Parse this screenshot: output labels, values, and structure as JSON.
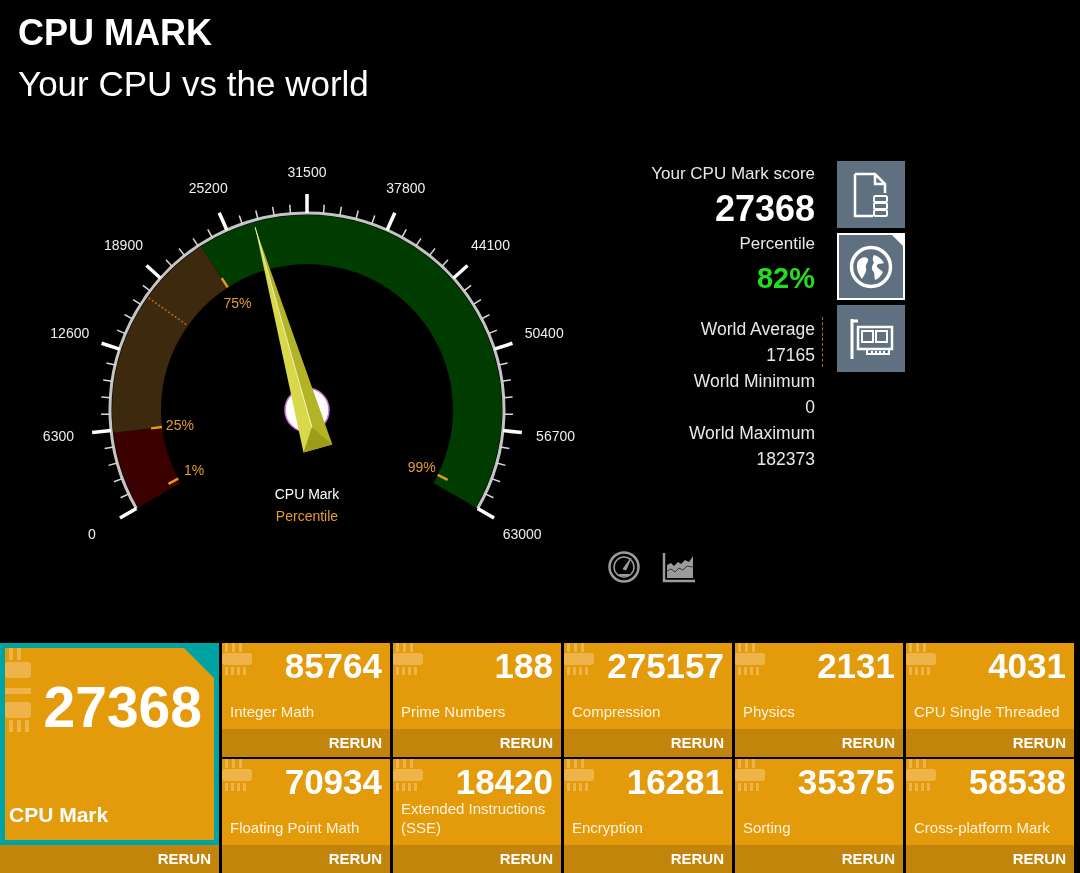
{
  "header": {
    "title": "CPU MARK",
    "subtitle": "Your CPU vs the world"
  },
  "gauge": {
    "scale_labels": [
      "0",
      "6300",
      "12600",
      "18900",
      "25200",
      "31500",
      "37800",
      "44100",
      "50400",
      "56700",
      "63000"
    ],
    "bands": [
      {
        "color": "#3b0000"
      },
      {
        "color": "#3d290d"
      },
      {
        "color": "#003b00"
      }
    ],
    "markers": [
      {
        "kind": "percentile",
        "label": "1%"
      },
      {
        "kind": "percentile",
        "label": "25%"
      },
      {
        "kind": "average"
      },
      {
        "kind": "percentile",
        "label": "75%"
      },
      {
        "kind": "percentile",
        "label": "99%"
      }
    ],
    "needle": {
      "level": 0.434
    },
    "title": "CPU Mark",
    "subtitle": "Percentile"
  },
  "summary": {
    "score_label": "Your CPU Mark score",
    "score": "27368",
    "percentile_label": "Percentile",
    "percentile": "82%",
    "stats": [
      {
        "label": "World Average",
        "value": "17165",
        "marked": true
      },
      {
        "label": "World Minimum",
        "value": "0",
        "marked": false
      },
      {
        "label": "World Maximum",
        "value": "182373",
        "marked": false
      }
    ]
  },
  "side_buttons": [
    {
      "kind": "report",
      "selected": false
    },
    {
      "kind": "globe",
      "selected": true
    },
    {
      "kind": "card",
      "selected": false
    }
  ],
  "view_buttons": [
    {
      "kind": "gauge"
    },
    {
      "kind": "chart"
    }
  ],
  "tiles": [
    {
      "kind": "overall",
      "score": "27368",
      "label": "CPU Mark",
      "action": "RERUN",
      "selected": true
    },
    {
      "kind": "test",
      "score": "85764",
      "label": "Integer Math",
      "action": "RERUN",
      "selected": false
    },
    {
      "kind": "test",
      "score": "188",
      "label": "Prime Numbers",
      "action": "RERUN",
      "selected": false
    },
    {
      "kind": "test",
      "score": "275157",
      "label": "Compression",
      "action": "RERUN",
      "selected": false
    },
    {
      "kind": "test",
      "score": "2131",
      "label": "Physics",
      "action": "RERUN",
      "selected": false
    },
    {
      "kind": "test",
      "score": "4031",
      "label": "CPU Single Threaded",
      "action": "RERUN",
      "selected": false
    },
    {
      "kind": "test",
      "score": "70934",
      "label": "Floating Point Math",
      "action": "RERUN",
      "selected": false
    },
    {
      "kind": "test",
      "score": "18420",
      "label": "Extended Instructions (SSE)",
      "action": "RERUN",
      "selected": false
    },
    {
      "kind": "test",
      "score": "16281",
      "label": "Encryption",
      "action": "RERUN",
      "selected": false
    },
    {
      "kind": "test",
      "score": "35375",
      "label": "Sorting",
      "action": "RERUN",
      "selected": false
    },
    {
      "kind": "test",
      "score": "58538",
      "label": "Cross-platform Mark",
      "action": "RERUN",
      "selected": false
    }
  ]
}
